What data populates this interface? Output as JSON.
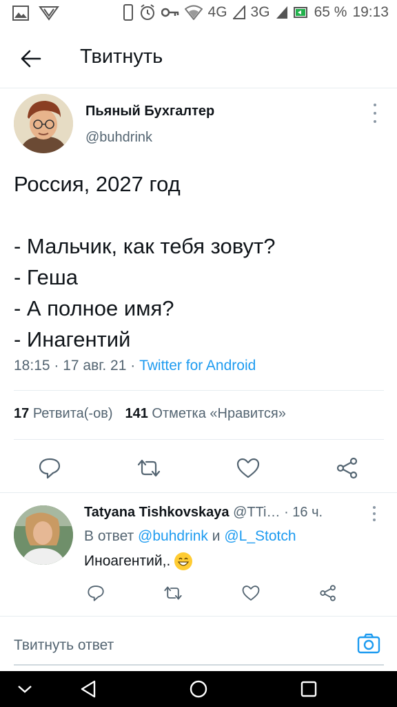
{
  "status_bar": {
    "battery_percent": "65 %",
    "time": "19:13",
    "network_1": "4G",
    "network_2": "3G",
    "icons": [
      "gallery-icon",
      "vpn-icon",
      "phone-icon",
      "alarm-icon",
      "key-icon",
      "wifi-icon",
      "signal-icon",
      "battery-icon"
    ]
  },
  "header": {
    "title": "Твитнуть"
  },
  "tweet": {
    "author_name": "Пьяный Бухгалтер",
    "author_handle": "@buhdrink",
    "lines": [
      "Россия, 2027 год",
      "",
      "- Мальчик, как тебя зовут?",
      "- Геша",
      "- А полное имя?",
      "- Инагентий"
    ],
    "time": "18:15",
    "date": "17 авг. 21",
    "client": "Twitter for Android",
    "retweet_count": "17",
    "retweet_label": "Ретвита(-ов)",
    "like_count": "141",
    "like_label": "Отметка «Нравится»"
  },
  "reply": {
    "author_name": "Tatyana Tishkovskaya",
    "author_handle": "@TTi…",
    "time": "· 16 ч.",
    "reply_prefix": "В ответ",
    "mention_1": "@buhdrink",
    "conjunction": "и",
    "mention_2": "@L_Stotch",
    "text": "Иноагентий,."
  },
  "composer": {
    "placeholder": "Твитнуть ответ"
  },
  "colors": {
    "accent": "#1d9bf0",
    "text": "#0f1419",
    "secondary": "#536471",
    "divider": "#e6ecf0"
  }
}
